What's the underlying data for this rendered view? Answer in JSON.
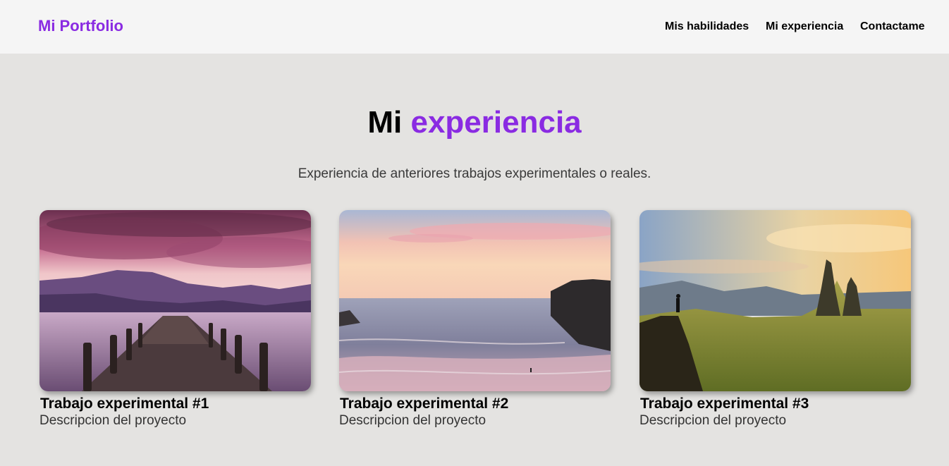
{
  "navbar": {
    "brand": "Mi Portfolio",
    "links": [
      "Mis habilidades",
      "Mi experiencia",
      "Contactame"
    ]
  },
  "hero": {
    "title_plain": "Mi",
    "title_accent": "experiencia",
    "subtitle": "Experiencia de anteriores trabajos experimentales o reales."
  },
  "projects": [
    {
      "title": "Trabajo experimental #1",
      "description": "Descripcion del proyecto",
      "image": "lake-pier-sunset-photo"
    },
    {
      "title": "Trabajo experimental #2",
      "description": "Descripcion del proyecto",
      "image": "beach-sunset-photo"
    },
    {
      "title": "Trabajo experimental #3",
      "description": "Descripcion del proyecto",
      "image": "mountain-hiker-photo"
    }
  ],
  "colors": {
    "accent": "#8a2be2",
    "background": "#e4e3e1",
    "navbar": "#f5f5f5"
  }
}
